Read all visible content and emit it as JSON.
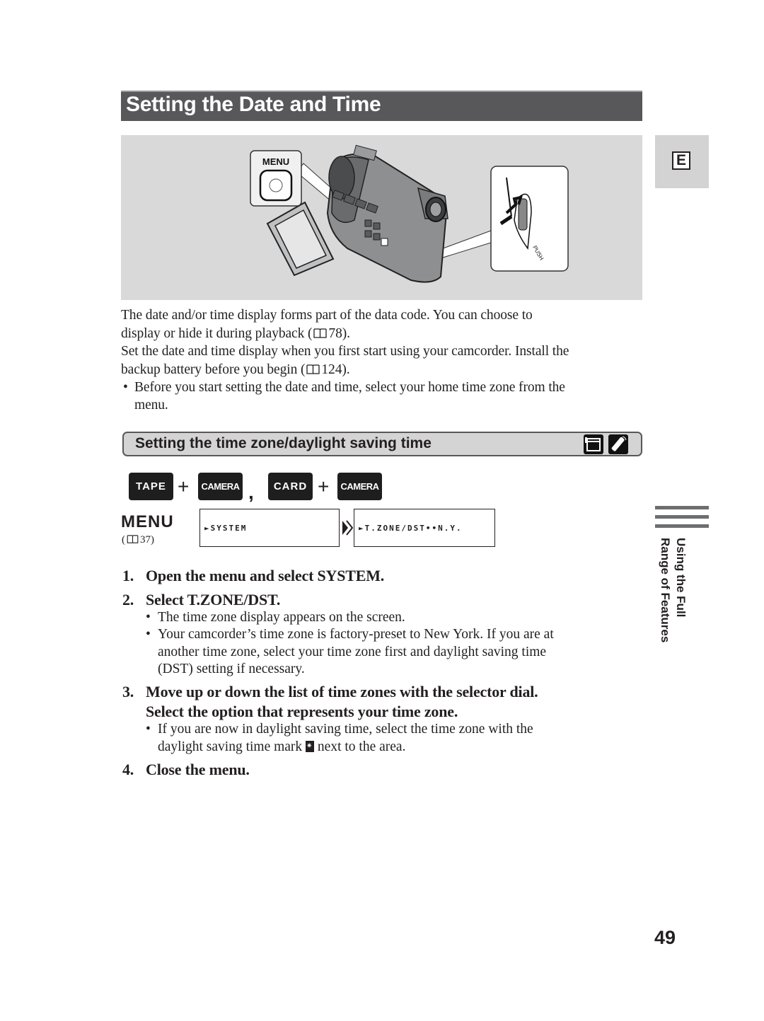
{
  "page": {
    "title": "Setting the Date and Time",
    "language_tab": "E",
    "page_number": "49",
    "side_label": [
      "Using the Full",
      "Range of Features"
    ]
  },
  "illustration": {
    "menu_button_label": "MENU",
    "push_label": "PUSH",
    "icons": [
      "camcorder-illustration",
      "menu-button-callout",
      "selector-dial-callout"
    ]
  },
  "intro": {
    "para1_a": "The date and/or time display forms part of the data code. You can choose to",
    "para1_b": "display or hide it during playback (",
    "para1_ref": "78).",
    "para2_a": "Set the date and time display when you first start using your camcorder. Install the",
    "para2_b": "backup battery before you begin (",
    "para2_ref": "124).",
    "bullet_a": "Before you start setting the date and time, select your home time zone from the",
    "bullet_b": "menu."
  },
  "section": {
    "title": "Setting the time zone/daylight saving time",
    "icons": [
      "camcorder-mode-icon",
      "remote-control-icon"
    ]
  },
  "modes": {
    "tape": "TAPE",
    "camera1": "CAMERA",
    "card": "CARD",
    "camera2": "CAMERA",
    "plus": "+",
    "comma": ","
  },
  "menu": {
    "label": "MENU",
    "ref_open": "(",
    "ref_page": "37)",
    "box1": "►SYSTEM",
    "box2": "►T.ZONE/DST••N.Y."
  },
  "steps": [
    {
      "num": "1.",
      "text": "Open the menu and select SYSTEM."
    },
    {
      "num": "2.",
      "text": "Select T.ZONE/DST.",
      "bullets": [
        [
          "The time zone display appears on the screen."
        ],
        [
          "Your camcorder’s time zone is factory-preset to New York. If you are at",
          "another time zone, select your time zone first and daylight saving time",
          "(DST) setting if necessary."
        ]
      ]
    },
    {
      "num": "3.",
      "text": "Move up or down the list of time zones with the selector dial.",
      "text2": "Select the option that represents your time zone.",
      "bullets": [
        [
          "If you are now in daylight saving time, select the time zone with the",
          "daylight saving time mark",
          "next to the area."
        ]
      ]
    },
    {
      "num": "4.",
      "text": "Close the menu."
    }
  ],
  "bullet_char": "•"
}
